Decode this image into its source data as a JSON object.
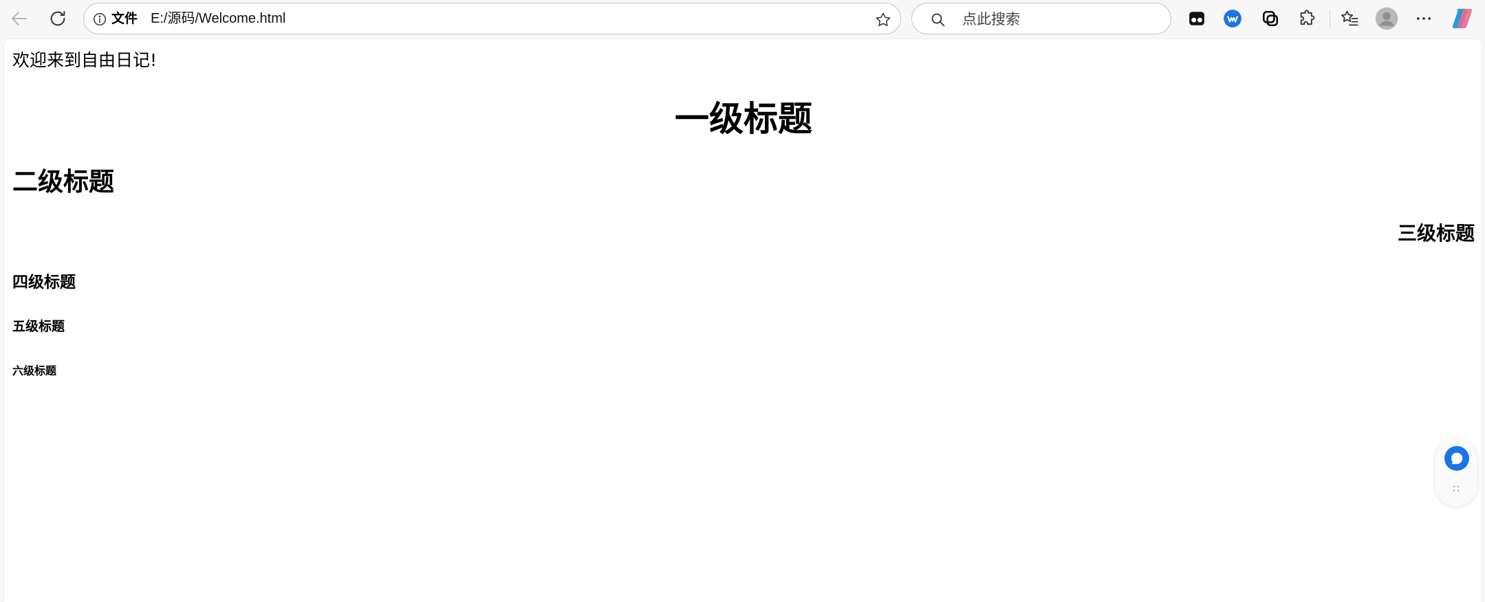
{
  "browser": {
    "address": {
      "file_label": "文件",
      "url": "E:/源码/Welcome.html"
    },
    "search": {
      "placeholder": "点此搜索"
    },
    "icons": [
      "back-icon",
      "refresh-icon",
      "info-icon",
      "favorite-star-icon",
      "search-icon",
      "tab-actions-icon",
      "browser-essentials-icon",
      "collections-icon",
      "extensions-icon",
      "favorites-icon",
      "profile-avatar-icon",
      "more-menu-icon",
      "copilot-icon"
    ]
  },
  "page": {
    "intro": "欢迎来到自由日记!",
    "h1": "一级标题",
    "h2": "二级标题",
    "h3": "三级标题",
    "h4": "四级标题",
    "h5": "五级标题",
    "h6": "六级标题"
  },
  "colors": {
    "accent_blue": "#1a73e8",
    "chrome_bg": "#f7f7f7"
  }
}
